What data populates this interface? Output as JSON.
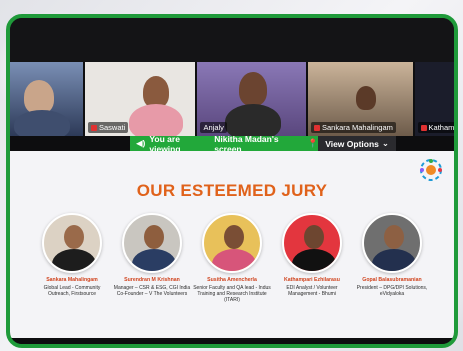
{
  "participants": [
    {
      "name": "",
      "bg": "#3a4a6b"
    },
    {
      "name": "Saswati",
      "bg": "#e6e3e0"
    },
    {
      "name": "Anjaly",
      "bg": "#6e5a9a"
    },
    {
      "name": "Sankara Mahalingam",
      "bg": "#7b6c5e"
    },
    {
      "name": "Katham",
      "bg": "#1a1c2a"
    }
  ],
  "banner": {
    "viewing_text": "You are viewing",
    "presenter": "Nikitha Madan's screen",
    "options_label": "View Options"
  },
  "slide": {
    "title": "OUR ESTEEMED JURY",
    "jury": [
      {
        "name": "Sankara Mahalingam",
        "role": "Global Lead - Community Outreach, Firstsource",
        "bg": "#dcd2c4",
        "shirt": "#1d1d1d",
        "skin": "#9a6a4a"
      },
      {
        "name": "Surendran M Krishnan",
        "role": "Manager – CSR & ESG, CGI India Co-Founder – V The Volunteers",
        "bg": "#c9c6c0",
        "shirt": "#2a3d63",
        "skin": "#8e5e3e"
      },
      {
        "name": "Susitha Amencherla",
        "role": "Senior Faculty and QA lead - Indus Training and Research Institute (ITARI)",
        "bg": "#e8c15a",
        "shirt": "#d7557a",
        "skin": "#7a4e35"
      },
      {
        "name": "Kathampari Ezhilarasu",
        "role": "EDI Analyst / Volunteer Management - Bhumi",
        "bg": "#e3363e",
        "shirt": "#111111",
        "skin": "#6d4630"
      },
      {
        "name": "Gopal Balasubramanian",
        "role": "President – DPG/DPI Solutions, eVidyaloka",
        "bg": "#6f6f6f",
        "shirt": "#23304e",
        "skin": "#8d6043"
      }
    ]
  },
  "colors": {
    "frame": "#1f9a3a",
    "title": "#e0621b",
    "banner": "#22a83a"
  }
}
